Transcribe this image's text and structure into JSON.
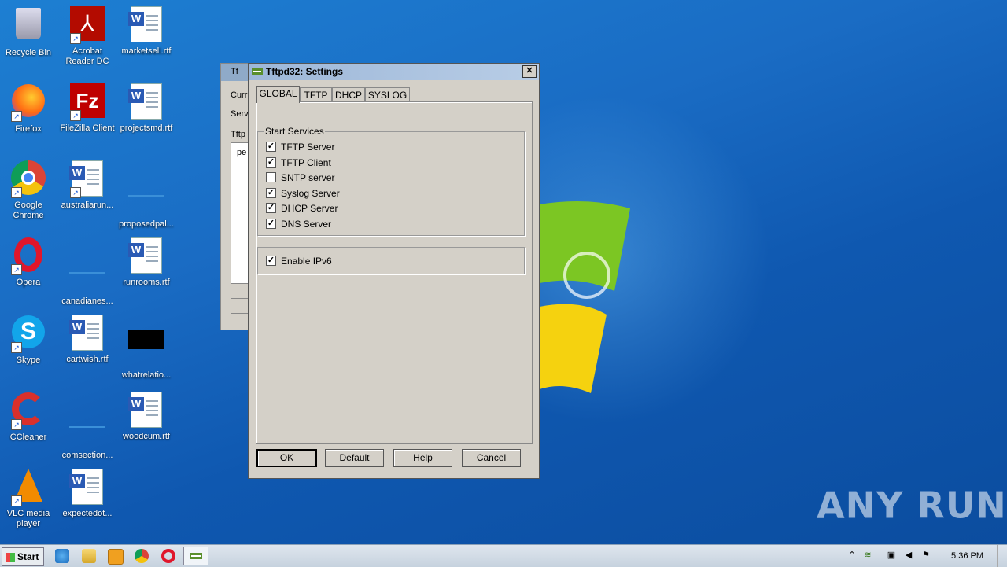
{
  "desktop": {
    "icons": [
      {
        "label": "Recycle Bin"
      },
      {
        "label": "Acrobat Reader DC"
      },
      {
        "label": "marketsell.rtf"
      },
      {
        "label": "Firefox"
      },
      {
        "label": "FileZilla Client"
      },
      {
        "label": "projectsmd.rtf"
      },
      {
        "label": "Google Chrome"
      },
      {
        "label": "australiarun..."
      },
      {
        "label": "proposedpal..."
      },
      {
        "label": "Opera"
      },
      {
        "label": "canadianes..."
      },
      {
        "label": "runrooms.rtf"
      },
      {
        "label": "Skype"
      },
      {
        "label": "cartwish.rtf"
      },
      {
        "label": "whatrelatio..."
      },
      {
        "label": "CCleaner"
      },
      {
        "label": "comsection..."
      },
      {
        "label": "woodcum.rtf"
      },
      {
        "label": "VLC media player"
      },
      {
        "label": "expectedot..."
      }
    ],
    "watermark": "ANY RUN"
  },
  "background_window": {
    "title_fragment": "Tf",
    "label1": "Curr",
    "label2": "Serv",
    "tab": "Tftp",
    "list_item": "pe"
  },
  "dialog": {
    "title": "Tftpd32: Settings",
    "close": "✕",
    "tabs": [
      {
        "label": "GLOBAL",
        "active": true
      },
      {
        "label": "TFTP",
        "active": false
      },
      {
        "label": "DHCP",
        "active": false
      },
      {
        "label": "SYSLOG",
        "active": false
      }
    ],
    "group_title": "Start Services",
    "services": [
      {
        "label": "TFTP Server",
        "checked": true
      },
      {
        "label": "TFTP Client",
        "checked": true
      },
      {
        "label": "SNTP server",
        "checked": false
      },
      {
        "label": "Syslog Server",
        "checked": true
      },
      {
        "label": "DHCP Server",
        "checked": true
      },
      {
        "label": "DNS Server",
        "checked": true
      }
    ],
    "ipv6": {
      "label": "Enable IPv6",
      "checked": true
    },
    "buttons": {
      "ok": "OK",
      "default": "Default",
      "help": "Help",
      "cancel": "Cancel"
    }
  },
  "taskbar": {
    "start": "Start",
    "clock": "5:36 PM"
  },
  "colors": {
    "accent": "#1a6cc4",
    "dialog_bg": "#d4d0c8"
  }
}
